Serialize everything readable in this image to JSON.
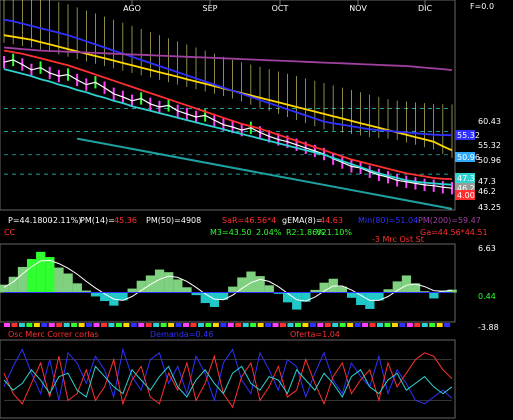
{
  "chart_data": [
    {
      "type": "line",
      "months": [
        "AGO",
        "SEP",
        "OCT",
        "NOV",
        "DIC"
      ],
      "corner_label": "F=0.0",
      "y_ticks": [
        "60.43",
        "55.32",
        "50.96",
        "47.3",
        "46.2",
        "43.25"
      ],
      "badges": [
        {
          "text": "55.32",
          "color": "#3030ff"
        },
        {
          "text": "50.96",
          "color": "#2fa8ff"
        },
        {
          "text": "47.3",
          "color": "#2fd0d0"
        },
        {
          "text": "46.2",
          "color": "#9a9a9a"
        },
        {
          "text": "4.00",
          "color": "#ff3030"
        }
      ],
      "info_row1": [
        {
          "text": "P=44.1800",
          "color": "#ffffff"
        },
        {
          "text": "-2.11%)",
          "color": "#ffffff"
        },
        {
          "text": "PM(14)=",
          "color": "#ffffff"
        },
        {
          "text": "45.36",
          "color": "#ff3030"
        },
        {
          "text": "PM(50)=4908",
          "color": "#ffffff"
        },
        {
          "text": "SaR=46.56*4",
          "color": "#ff3030"
        },
        {
          "text": "gEMA(8)=",
          "color": "#ffffff"
        },
        {
          "text": "44.63",
          "color": "#ff3030"
        },
        {
          "text": "Min(80)=51.04",
          "color": "#3030ff"
        },
        {
          "text": "PM(200)=59.47",
          "color": "#a040a0"
        }
      ],
      "info_row2": [
        {
          "text": "CC",
          "color": "#ff3030"
        },
        {
          "text": "M3=43.50",
          "color": "#30ff30"
        },
        {
          "text": "2.04%",
          "color": "#30ff30"
        },
        {
          "text": "R2:1.86%",
          "color": "#30ff30"
        },
        {
          "text": "V21.10%",
          "color": "#30ff30"
        },
        {
          "text": "Ga=44.56*44.51",
          "color": "#ff3030"
        }
      ],
      "series": [
        {
          "name": "price",
          "color": "#ffffff",
          "values": [
            60.5,
            60.8,
            60.2,
            59.5,
            59.8,
            59.1,
            58.7,
            58.9,
            58.2,
            57.6,
            57.9,
            57.2,
            56.4,
            56.0,
            55.5,
            55.8,
            55.1,
            54.7,
            54.9,
            54.2,
            53.8,
            53.4,
            53.6,
            53.0,
            52.4,
            52.1,
            51.7,
            52.0,
            51.4,
            50.9,
            50.5,
            50.2,
            49.8,
            49.4,
            49.0,
            48.6,
            48.0,
            47.5,
            47.0,
            46.8,
            46.3,
            45.9,
            45.6,
            45.2,
            45.0,
            44.8,
            44.6,
            44.5,
            44.3,
            44.18
          ]
        },
        {
          "name": "PM(14)",
          "color": "#ff3030",
          "values": [
            62.0,
            61.8,
            61.6,
            61.3,
            61.0,
            60.7,
            60.4,
            60.1,
            59.7,
            59.3,
            58.9,
            58.5,
            58.1,
            57.7,
            57.3,
            56.9,
            56.5,
            56.1,
            55.7,
            55.3,
            54.9,
            54.5,
            54.1,
            53.7,
            53.3,
            52.9,
            52.5,
            52.2,
            51.9,
            51.5,
            51.1,
            50.7,
            50.3,
            49.9,
            49.5,
            49.1,
            48.7,
            48.3,
            47.9,
            47.6,
            47.3,
            47.0,
            46.7,
            46.4,
            46.1,
            45.9,
            45.7,
            45.5,
            45.4,
            45.36
          ]
        },
        {
          "name": "PM(50)",
          "color": "#ffd700",
          "values": [
            64.0,
            63.8,
            63.6,
            63.4,
            63.1,
            62.8,
            62.5,
            62.2,
            61.9,
            61.6,
            61.3,
            61.0,
            60.7,
            60.4,
            60.1,
            59.8,
            59.5,
            59.2,
            58.9,
            58.6,
            58.3,
            58.0,
            57.7,
            57.4,
            57.1,
            56.8,
            56.5,
            56.2,
            55.9,
            55.6,
            55.3,
            55.0,
            54.7,
            54.4,
            54.1,
            53.8,
            53.5,
            53.2,
            52.9,
            52.6,
            52.3,
            52.0,
            51.7,
            51.4,
            51.1,
            50.8,
            50.5,
            50.2,
            49.6,
            49.08
          ]
        },
        {
          "name": "Min(80)",
          "color": "#3030ff",
          "values": [
            66.0,
            65.8,
            65.5,
            65.2,
            64.9,
            64.6,
            64.3,
            64.0,
            63.6,
            63.2,
            62.8,
            62.4,
            62.0,
            61.6,
            61.2,
            60.8,
            60.4,
            60.0,
            59.6,
            59.2,
            58.8,
            58.4,
            58.0,
            57.6,
            57.2,
            56.8,
            56.4,
            56.0,
            55.6,
            55.2,
            54.8,
            54.4,
            54.0,
            53.6,
            53.2,
            52.8,
            52.6,
            52.4,
            52.2,
            52.0,
            51.8,
            51.7,
            51.6,
            51.5,
            51.4,
            51.3,
            51.2,
            51.1,
            51.06,
            51.04
          ]
        },
        {
          "name": "PM(200)",
          "color": "#a040a0",
          "values": [
            62.4,
            62.3,
            62.2,
            62.1,
            62.0,
            61.95,
            61.9,
            61.85,
            61.8,
            61.75,
            61.7,
            61.65,
            61.6,
            61.55,
            61.5,
            61.45,
            61.4,
            61.35,
            61.3,
            61.25,
            61.2,
            61.15,
            61.1,
            61.05,
            61.0,
            60.95,
            60.9,
            60.85,
            60.8,
            60.75,
            60.7,
            60.65,
            60.6,
            60.55,
            60.5,
            60.45,
            60.4,
            60.35,
            60.3,
            60.25,
            60.2,
            60.15,
            60.1,
            60.05,
            60.0,
            59.9,
            59.8,
            59.7,
            59.6,
            59.47
          ]
        },
        {
          "name": "gEMA(8)",
          "color": "#2fd0d0",
          "values": [
            59.6,
            59.3,
            59.0,
            58.7,
            58.3,
            58.0,
            57.6,
            57.3,
            56.9,
            56.6,
            56.2,
            55.9,
            55.5,
            55.2,
            54.8,
            54.5,
            54.2,
            53.9,
            53.6,
            53.3,
            53.0,
            52.7,
            52.4,
            52.1,
            51.8,
            51.5,
            51.2,
            50.9,
            50.6,
            50.3,
            50.0,
            49.7,
            49.4,
            49.1,
            48.8,
            48.5,
            48.1,
            47.7,
            47.3,
            46.9,
            46.5,
            46.1,
            45.8,
            45.5,
            45.2,
            45.0,
            44.9,
            44.8,
            44.7,
            44.63
          ]
        }
      ]
    },
    {
      "type": "area",
      "label": "-3 Mrc Ost St",
      "y_ticks": [
        "6.63",
        "0.44",
        "-3.88"
      ],
      "ylim": [
        -3.88,
        6.63
      ],
      "values": [
        1.2,
        2.4,
        3.9,
        5.1,
        6.2,
        5.4,
        3.8,
        2.9,
        1.4,
        0.3,
        -0.6,
        -1.3,
        -2.0,
        -1.2,
        0.6,
        1.8,
        2.6,
        3.5,
        3.1,
        2.0,
        0.8,
        -0.4,
        -1.6,
        -2.2,
        -1.1,
        0.9,
        2.3,
        3.2,
        2.5,
        1.1,
        -0.2,
        -1.5,
        -2.6,
        -1.4,
        0.4,
        1.5,
        2.1,
        0.9,
        -0.8,
        -1.9,
        -2.5,
        -1.2,
        0.5,
        1.7,
        2.6,
        1.4,
        0.2,
        -0.9,
        0.3,
        0.44
      ],
      "signal": [
        0.8,
        1.6,
        2.8,
        3.9,
        4.8,
        4.9,
        4.4,
        3.7,
        2.8,
        1.7,
        0.7,
        -0.2,
        -1.0,
        -1.2,
        -0.6,
        0.3,
        1.2,
        2.0,
        2.5,
        2.3,
        1.7,
        0.8,
        -0.2,
        -1.0,
        -1.1,
        -0.4,
        0.6,
        1.5,
        2.0,
        1.7,
        0.9,
        -0.1,
        -1.1,
        -1.3,
        -0.7,
        0.2,
        1.0,
        1.0,
        0.4,
        -0.4,
        -1.2,
        -1.2,
        -0.6,
        0.3,
        1.1,
        1.3,
        0.9,
        0.3,
        0.2,
        0.35
      ]
    },
    {
      "type": "line",
      "labels": [
        {
          "text": "Osc Merc Correr corlas",
          "color": "#ff3030"
        },
        {
          "text": "Demanda=0.46",
          "color": "#3030ff"
        },
        {
          "text": "Oferta=1.04",
          "color": "#ff3030"
        }
      ],
      "ylim": [
        0,
        2
      ],
      "series": [
        {
          "name": "Demanda",
          "color": "#3030ff",
          "values": [
            0.8,
            1.4,
            1.9,
            1.2,
            0.6,
            1.6,
            0.4,
            1.8,
            1.5,
            0.9,
            1.7,
            1.3,
            0.5,
            1.9,
            1.1,
            0.7,
            1.6,
            1.8,
            0.9,
            1.4,
            0.6,
            1.7,
            1.2,
            0.4,
            1.5,
            1.9,
            1.0,
            0.6,
            1.8,
            1.3,
            0.7,
            1.6,
            1.4,
            0.5,
            1.2,
            1.8,
            1.0,
            0.6,
            1.5,
            1.1,
            0.8,
            1.7,
            0.6,
            1.3,
            0.9,
            0.4,
            0.3,
            0.5,
            0.7,
            0.46
          ]
        },
        {
          "name": "Oferta",
          "color": "#ff3030",
          "values": [
            1.2,
            0.6,
            0.3,
            0.9,
            1.5,
            0.5,
            1.7,
            0.4,
            0.6,
            1.3,
            0.4,
            0.8,
            1.6,
            0.3,
            1.0,
            1.4,
            0.5,
            0.3,
            1.2,
            0.7,
            1.5,
            0.4,
            0.9,
            1.7,
            0.6,
            0.2,
            1.1,
            1.5,
            0.4,
            0.8,
            1.4,
            0.5,
            0.7,
            1.6,
            0.9,
            0.3,
            1.1,
            1.5,
            0.6,
            1.0,
            1.3,
            0.4,
            1.5,
            0.8,
            1.2,
            1.6,
            1.8,
            1.7,
            1.3,
            1.04
          ]
        },
        {
          "name": "",
          "color": "#2fd0d0",
          "values": [
            1.0,
            0.7,
            0.9,
            1.3,
            1.0,
            0.6,
            1.1,
            1.2,
            0.7,
            0.5,
            1.4,
            1.1,
            0.8,
            0.6,
            1.3,
            1.0,
            0.7,
            1.1,
            1.4,
            0.8,
            0.5,
            1.0,
            1.3,
            0.9,
            0.6,
            1.2,
            1.4,
            0.9,
            0.7,
            1.1,
            1.0,
            0.6,
            1.3,
            1.0,
            0.7,
            1.2,
            0.9,
            0.5,
            1.1,
            1.3,
            0.8,
            0.6,
            1.0,
            1.2,
            0.7,
            0.9,
            1.1,
            0.8,
            0.6,
            0.8
          ]
        }
      ]
    }
  ]
}
